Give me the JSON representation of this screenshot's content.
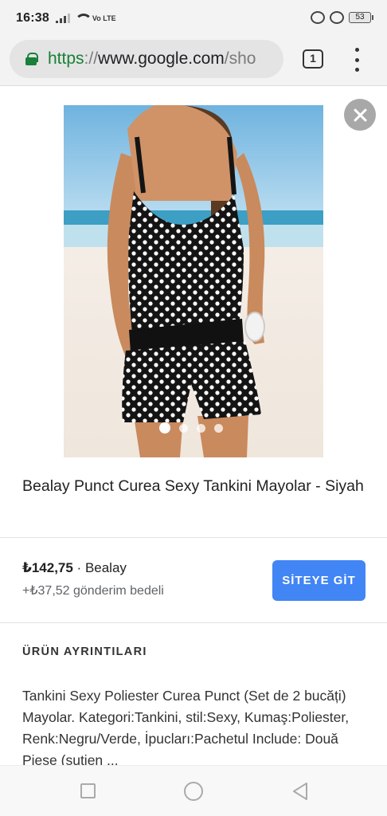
{
  "status_bar": {
    "time": "16:38",
    "volte_label": "Vo LTE",
    "battery": "53"
  },
  "browser": {
    "url_scheme": "https",
    "url_separator": "://",
    "url_host": "www.google.com",
    "url_path": "/sho",
    "tab_count": "1"
  },
  "product": {
    "title": "Bealay Punct Curea Sexy Tankini Mayolar - Siyah",
    "price": "₺142,75",
    "seller_separator": " · ",
    "seller": "Bealay",
    "shipping": "+₺37,52 gönderim bedeli",
    "cta_label": "SİTEYE GİT",
    "image_count": 4,
    "active_image_index": 0
  },
  "details": {
    "heading": "ÜRÜN AYRINTILARI",
    "body": "Tankini Sexy Poliester Curea Punct (Set de 2 bucăți) Mayolar. Kategori:Tankini, stil:Sexy, Kumaş:Poliester, Renk:Negru/Verde, İpucları:Pachetul Include: Două Piese (sutien ..."
  },
  "icons": {
    "lock": "lock-icon",
    "close": "close-icon",
    "menu": "more-vert-icon",
    "nav_recent": "recent-apps-icon",
    "nav_home": "home-icon",
    "nav_back": "back-icon"
  },
  "colors": {
    "accent": "#4285f4",
    "secure": "#188038"
  }
}
